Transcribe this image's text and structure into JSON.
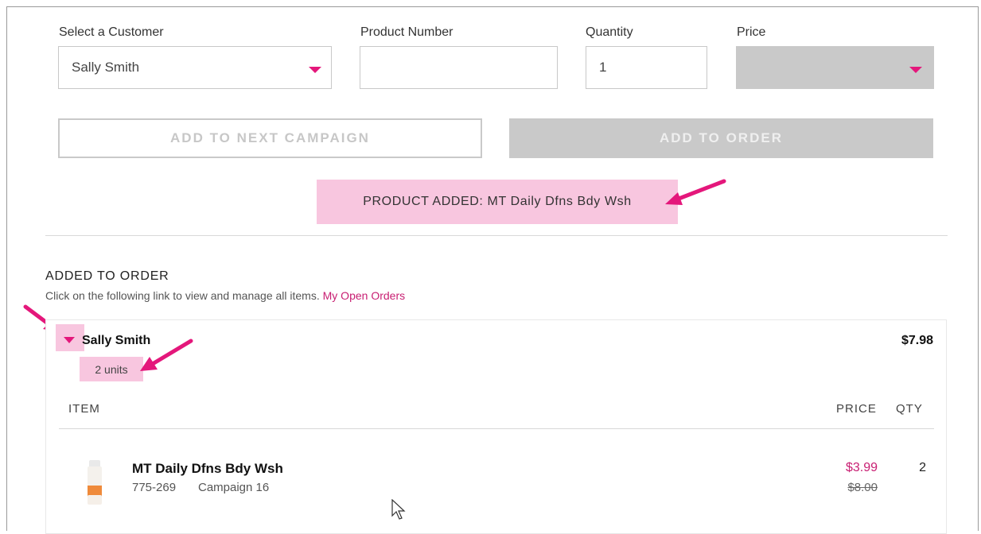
{
  "form": {
    "customer_label": "Select a Customer",
    "customer_value": "Sally Smith",
    "product_label": "Product Number",
    "product_value": "",
    "quantity_label": "Quantity",
    "quantity_value": "1",
    "price_label": "Price",
    "price_value": ""
  },
  "buttons": {
    "next_campaign": "ADD TO NEXT CAMPAIGN",
    "add_to_order": "ADD TO ORDER"
  },
  "toast": {
    "prefix": "PRODUCT ADDED:",
    "product": "MT Daily Dfns Bdy Wsh"
  },
  "order": {
    "section_title": "ADDED TO ORDER",
    "hint": "Click on the following link to view and manage all items.",
    "link": "My Open Orders",
    "customer_name": "Sally Smith",
    "units": "2 units",
    "total": "$7.98",
    "columns": {
      "item": "ITEM",
      "price": "PRICE",
      "qty": "QTY"
    },
    "items": [
      {
        "name": "MT Daily Dfns Bdy Wsh",
        "number": "775-269",
        "campaign": "Campaign 16",
        "price": "$3.99",
        "original_price": "$8.00",
        "qty": "2"
      }
    ]
  },
  "colors": {
    "accent": "#e4177b",
    "highlight": "#f8c6df",
    "sale_price": "#c81e72",
    "disabled": "#c9c9c9"
  }
}
